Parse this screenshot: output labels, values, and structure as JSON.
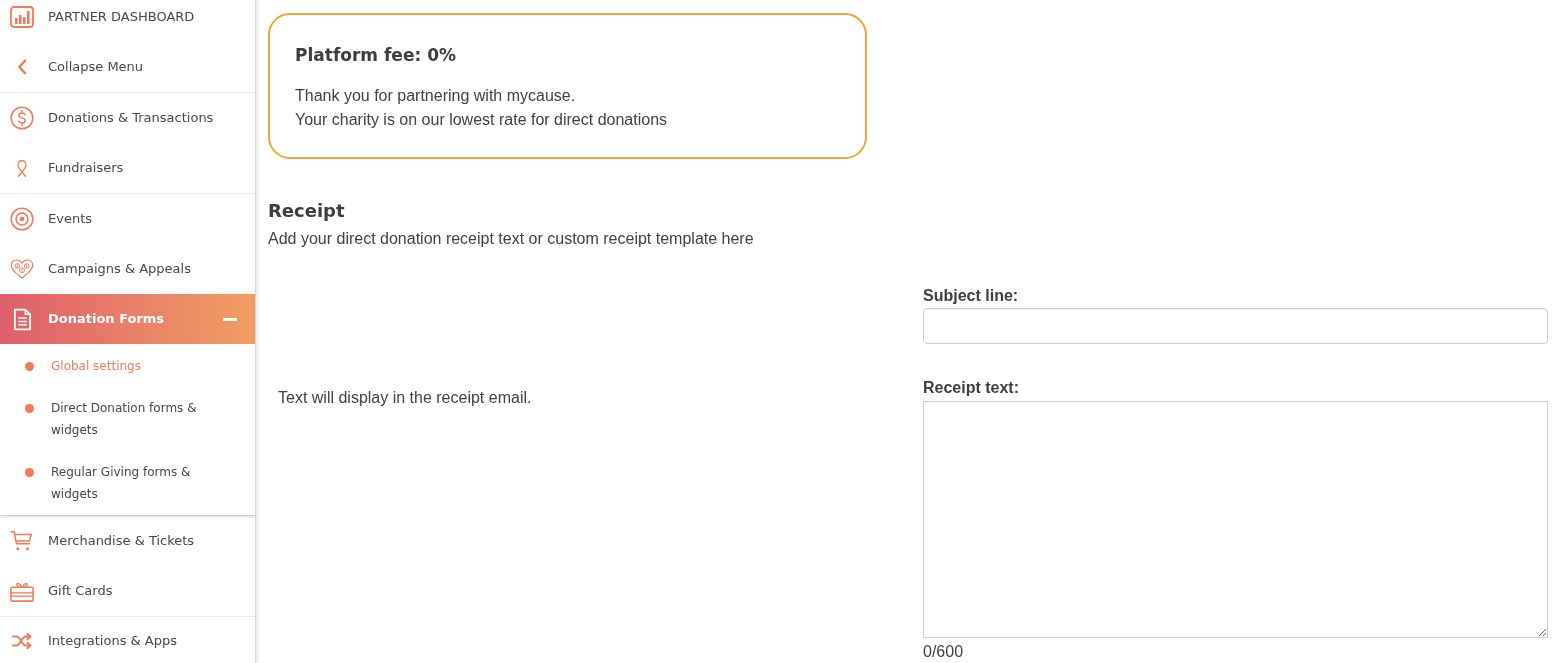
{
  "sidebar": {
    "groups": [
      {
        "items": [
          {
            "label": "PARTNER DASHBOARD",
            "selected": false
          },
          {
            "label": "Collapse Menu",
            "selected": false
          }
        ]
      },
      {
        "items": [
          {
            "label": "Donations & Transactions",
            "selected": false
          },
          {
            "label": "Fundraisers",
            "selected": false
          }
        ]
      },
      {
        "items": [
          {
            "label": "Events",
            "selected": false
          },
          {
            "label": "Campaigns & Appeals",
            "selected": false
          },
          {
            "label": "Donation Forms",
            "selected": true,
            "expanded": true,
            "children": [
              {
                "label": "Global settings",
                "selected": true
              },
              {
                "label": "Direct Donation forms & widgets",
                "selected": false
              },
              {
                "label": "Regular Giving forms & widgets",
                "selected": false
              }
            ]
          }
        ]
      },
      {
        "items": [
          {
            "label": "Merchandise & Tickets",
            "selected": false
          },
          {
            "label": "Gift Cards",
            "selected": false
          }
        ]
      },
      {
        "items": [
          {
            "label": "Integrations & Apps",
            "selected": false
          }
        ]
      }
    ]
  },
  "fee_card": {
    "title": "Platform fee: 0%",
    "lines": [
      "Thank you for partnering with mycause.",
      "Your charity is on our lowest rate for direct donations"
    ]
  },
  "receipt": {
    "heading": "Receipt",
    "description": "Add your direct donation receipt text or custom receipt template here",
    "note": "Text will display in the receipt email.",
    "fields": [
      {
        "kind": "input",
        "label": "Subject line:"
      },
      {
        "kind": "textarea",
        "label": "Receipt text:",
        "counter": "0/600"
      }
    ]
  }
}
